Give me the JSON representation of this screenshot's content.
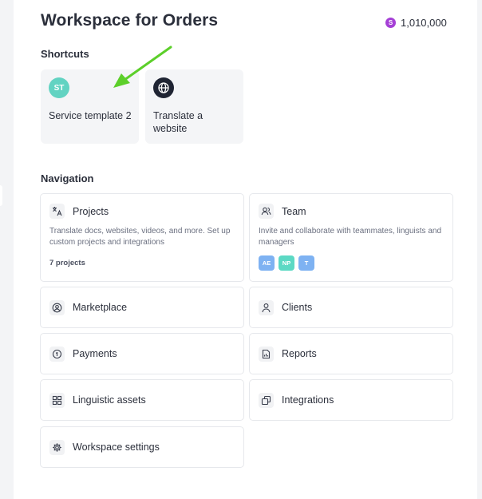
{
  "header": {
    "title": "Workspace for Orders",
    "balance": "1,010,000",
    "balance_icon_glyph": "S"
  },
  "shortcuts": {
    "title": "Shortcuts",
    "items": [
      {
        "initials": "ST",
        "label": "Service template 2",
        "color": "#62d3c2"
      },
      {
        "icon": "globe-icon",
        "label": "Translate a website",
        "color": "#1f2433"
      }
    ]
  },
  "navigation": {
    "title": "Navigation",
    "projects": {
      "title": "Projects",
      "icon": "translate-icon",
      "description": "Translate docs, websites, videos, and more. Set up custom projects and integrations",
      "count": "7 projects"
    },
    "team": {
      "title": "Team",
      "icon": "users-icon",
      "description": "Invite and collaborate with teammates, linguists and managers",
      "members": [
        {
          "initials": "AE",
          "color": "#7eb2f2"
        },
        {
          "initials": "NP",
          "color": "#5cd9c4"
        },
        {
          "initials": "T",
          "color": "#7eb2f2"
        }
      ]
    },
    "marketplace": {
      "title": "Marketplace",
      "icon": "user-circle-icon"
    },
    "clients": {
      "title": "Clients",
      "icon": "person-icon"
    },
    "payments": {
      "title": "Payments",
      "icon": "coin-icon"
    },
    "reports": {
      "title": "Reports",
      "icon": "report-icon"
    },
    "linguistic_assets": {
      "title": "Linguistic assets",
      "icon": "grid-icon"
    },
    "integrations": {
      "title": "Integrations",
      "icon": "integrations-icon"
    },
    "workspace_settings": {
      "title": "Workspace settings",
      "icon": "gear-icon"
    }
  },
  "colors": {
    "accent_arrow": "#5ccf2a",
    "coin": "#a540d6"
  }
}
